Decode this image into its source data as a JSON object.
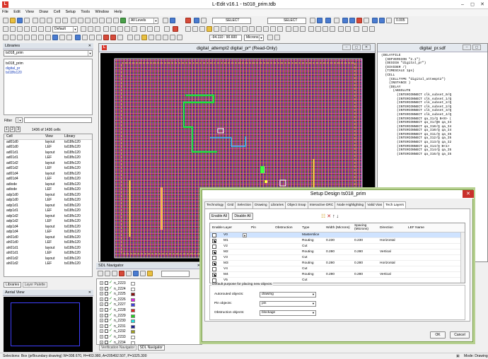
{
  "app": {
    "title": "L-Edit v16.1 - ts018_prim.tdb",
    "logo": "L"
  },
  "menu": [
    "File",
    "Edit",
    "View",
    "Draw",
    "Cell",
    "Setup",
    "Tools",
    "Window",
    "Help"
  ],
  "toolbar": {
    "layer_select": "All Levels",
    "select_label_1": "SELECT",
    "select_label_2": "SELECT",
    "snap_value": "0.005",
    "mode_select": "Default",
    "coord_readout": "-94.110 : 90.600",
    "units_select": "Microns"
  },
  "libraries": {
    "title": "Libraries",
    "combo": "ts018_prim",
    "items": [
      "ts018_prim",
      "digital_pr",
      "tsl18fs120"
    ]
  },
  "cells": {
    "filter_label": "Filter",
    "pages": [
      "1",
      "2",
      "3"
    ],
    "count": "1436 of 1436 cells",
    "headers": [
      "Cell",
      "View",
      "Library"
    ],
    "rows": [
      [
        "ad01d0",
        "layout",
        "tsl18fs120"
      ],
      [
        "ad01d0",
        "LEF",
        "tsl18fs120"
      ],
      [
        "ad01d1",
        "layout",
        "tsl18fs120"
      ],
      [
        "ad01d1",
        "LEF",
        "tsl18fs120"
      ],
      [
        "ad01d2",
        "layout",
        "tsl18fs120"
      ],
      [
        "ad01d2",
        "LEF",
        "tsl18fs120"
      ],
      [
        "ad01d4",
        "layout",
        "tsl18fs120"
      ],
      [
        "ad01d4",
        "LEF",
        "tsl18fs120"
      ],
      [
        "adiode",
        "layout",
        "tsl18fs120"
      ],
      [
        "adiode",
        "LEF",
        "tsl18fs120"
      ],
      [
        "adp1d0",
        "layout",
        "tsl18fs120"
      ],
      [
        "adp1d0",
        "LEF",
        "tsl18fs120"
      ],
      [
        "adp1d1",
        "layout",
        "tsl18fs120"
      ],
      [
        "adp1d1",
        "LEF",
        "tsl18fs120"
      ],
      [
        "adp1d2",
        "layout",
        "tsl18fs120"
      ],
      [
        "adp1d2",
        "LEF",
        "tsl18fs120"
      ],
      [
        "adp1d4",
        "layout",
        "tsl18fs120"
      ],
      [
        "adp1d4",
        "LEF",
        "tsl18fs120"
      ],
      [
        "ah01d0",
        "layout",
        "tsl18fs120"
      ],
      [
        "ah01d0",
        "LEF",
        "tsl18fs120"
      ],
      [
        "ah01d1",
        "layout",
        "tsl18fs120"
      ],
      [
        "ah01d1",
        "LEF",
        "tsl18fs120"
      ],
      [
        "ah01d2",
        "layout",
        "tsl18fs120"
      ],
      [
        "ah01d2",
        "LEF",
        "tsl18fs120"
      ]
    ],
    "bottom_tabs": [
      "Libraries",
      "Layer Palette"
    ]
  },
  "aerial": {
    "title": "Aerial View"
  },
  "layout_window": {
    "title": "digital_attempt2    digital_pr* (Read-Only)"
  },
  "sdf_window": {
    "title": "digital_pr.sdf",
    "lines": [
      "(DELAYFILE",
      "  (SDFVERSION \"2.1\")",
      "  (DESIGN \"digital_pr\")",
      "  (DIVIDER /)",
      "  (TIMESCALE 1ps)",
      "  (CELL",
      "    (CELLTYPE \"digital_attempt2\")",
      "    (INSTANCE )",
      "    (DELAY",
      "      (ABSOLUTE",
      "        (INTERCONNECT clk_subset_0/Q",
      "        (INTERCONNECT clk_subset_1/Q",
      "        (INTERCONNECT clk_subset_2/Q",
      "        (INTERCONNECT clk_subset_2/Q",
      "        (INTERCONNECT clk_subset_3/Q",
      "        (INTERCONNECT clk_subset_4/Q",
      "        (INTERCONNECT qa_I1/Q B<0> (",
      "        (INTERCONNECT qa_I1/QN qa_I4",
      "        (INTERCONNECT qa_I10/Q qa_I4",
      "        (INTERCONNECT qa_I10/Q qa_I4",
      "        (INTERCONNECT qa_I11/Q qa_I5",
      "        (INTERCONNECT qa_I12/Q qa_I5",
      "        (INTERCONNECT qa_I13/Q qa_I2",
      "        (INTERCONNECT qa_I14/Q B<1>",
      "        (INTERCONNECT qa_I14/Q qa_I5",
      "        (INTERCONNECT qa_I16/Q qa_I5"
    ]
  },
  "sdl_nav": {
    "title": "SDL Navigator",
    "items": [
      {
        "label": "n_2223",
        "color": "#ffffff"
      },
      {
        "label": "n_2224",
        "color": "#ffffff"
      },
      {
        "label": "n_2225",
        "color": "#8b1010"
      },
      {
        "label": "n_2226",
        "color": "#e020e0"
      },
      {
        "label": "n_2227",
        "color": "#4040e0"
      },
      {
        "label": "n_2228",
        "color": "#e02020"
      },
      {
        "label": "n_2229",
        "color": "#20d020"
      },
      {
        "label": "n_2230",
        "color": "#20e0e0"
      },
      {
        "label": "n_2231",
        "color": "#202090"
      },
      {
        "label": "n_2232",
        "color": "#a0a020"
      },
      {
        "label": "n_2233",
        "color": "#ffffff"
      },
      {
        "label": "n_2234",
        "color": "#ffffff"
      }
    ],
    "tabs": [
      "Verification Navigator",
      "SDL Navigator"
    ]
  },
  "dialog": {
    "title": "Setup Design ts018_prim",
    "tabs": [
      "Technology",
      "Grid",
      "Selection",
      "Drawing",
      "Libraries",
      "Object Snap",
      "Interactive DRC",
      "Node Highlighting",
      "Valid Vias",
      "Tech Layers"
    ],
    "active_tab": "Tech Layers",
    "enable_all": "Enable All",
    "disable_all": "Disable All",
    "headers": [
      "Enable",
      "Layer",
      "Pin",
      "Obstruction",
      "Type",
      "Width (Microns)",
      "Spacing (Microns)",
      "Direction",
      "LEF Name"
    ],
    "rows": [
      {
        "enabled": false,
        "layer": "V0",
        "type": "Masterslice",
        "width": "",
        "spacing": "",
        "direction": ""
      },
      {
        "enabled": true,
        "layer": "M1",
        "type": "Routing",
        "width": "0.230",
        "spacing": "0.230",
        "direction": "Horizontal"
      },
      {
        "enabled": false,
        "layer": "V2",
        "type": "Cut",
        "width": "",
        "spacing": "",
        "direction": ""
      },
      {
        "enabled": true,
        "layer": "M2",
        "type": "Routing",
        "width": "0.280",
        "spacing": "0.280",
        "direction": "Vertical"
      },
      {
        "enabled": false,
        "layer": "V3",
        "type": "Cut",
        "width": "",
        "spacing": "",
        "direction": ""
      },
      {
        "enabled": true,
        "layer": "M3",
        "type": "Routing",
        "width": "0.280",
        "spacing": "0.280",
        "direction": "Horizontal"
      },
      {
        "enabled": false,
        "layer": "V4",
        "type": "Cut",
        "width": "",
        "spacing": "",
        "direction": ""
      },
      {
        "enabled": true,
        "layer": "M4",
        "type": "Routing",
        "width": "0.280",
        "spacing": "0.280",
        "direction": "Vertical"
      },
      {
        "enabled": false,
        "layer": "V5",
        "type": "Cut",
        "width": "",
        "spacing": "",
        "direction": ""
      }
    ],
    "default_purpose_label": "Default purpose for placing new objects:",
    "autorouted_label": "Autorouted objects:",
    "autorouted_value": "drawing",
    "pin_label": "Pin objects:",
    "pin_value": "pin",
    "obstruction_label": "Obstruction objects:",
    "obstruction_value": "blockage",
    "ok": "OK",
    "cancel": "Cancel"
  },
  "status": {
    "left": "Selections: Box (prBoundary:drawing) W=308.670, H=403.980, A=205492.507, P=1025.300",
    "right": "Mode: Drawing"
  }
}
